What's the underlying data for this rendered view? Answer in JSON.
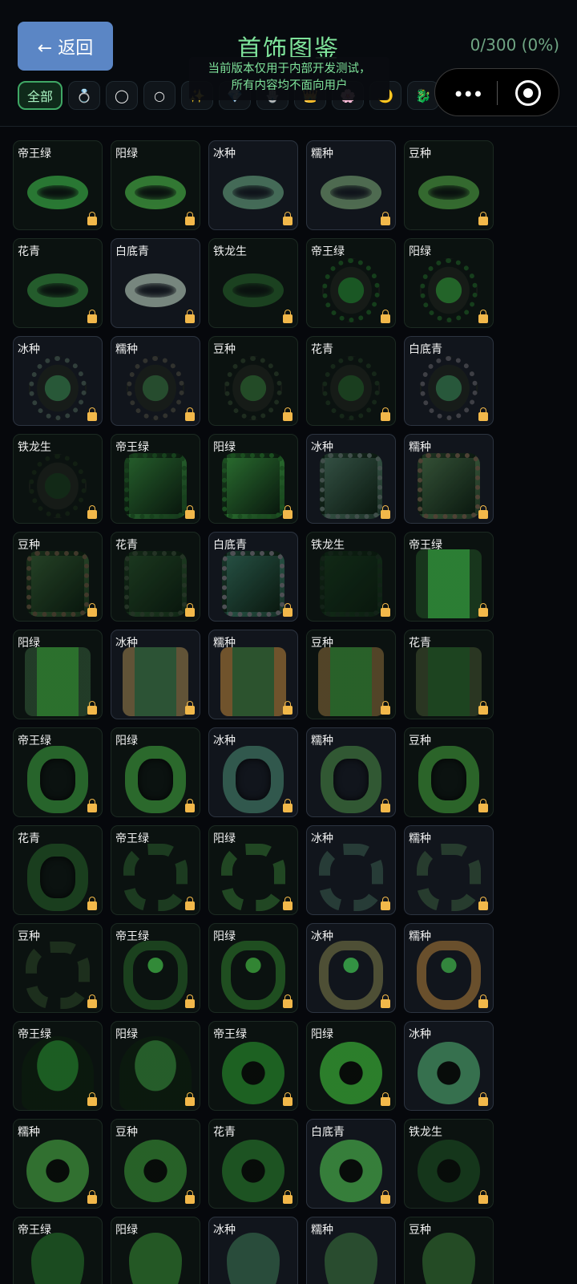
{
  "header": {
    "back_label": "← 返回",
    "title": "首饰图鉴",
    "progress": "0/300 (0%)",
    "notice_line1": "当前版本仅用于内部开发测试，",
    "notice_line2": "所有内容均不面向用户"
  },
  "filters": [
    {
      "label": "全部",
      "active": true
    },
    {
      "icon": "ring-icon",
      "glyph": "💍"
    },
    {
      "icon": "bracelet-icon",
      "glyph": "◯"
    },
    {
      "icon": "circle-icon",
      "glyph": "○"
    },
    {
      "icon": "sparkle-icon",
      "glyph": "✨"
    },
    {
      "icon": "gem-icon",
      "glyph": "💎"
    },
    {
      "icon": "pendant-icon",
      "glyph": "🪬"
    },
    {
      "icon": "crown-icon",
      "glyph": "👑"
    },
    {
      "icon": "flower-icon",
      "glyph": "🌸"
    },
    {
      "icon": "moon-icon",
      "glyph": "🌙"
    },
    {
      "icon": "dragon-icon",
      "glyph": "🐉"
    }
  ],
  "accent_color": "#7fe49b",
  "items": [
    {
      "label": "帝王绿",
      "shape": "ring",
      "c": "#2f8a3a",
      "c2": "#1d4a22"
    },
    {
      "label": "阳绿",
      "shape": "ring",
      "c": "#3a8b3a",
      "c2": "#1d4a22"
    },
    {
      "label": "冰种",
      "shape": "ring",
      "c": "#4e7a62",
      "c2": "#223a2e",
      "light": true
    },
    {
      "label": "糯种",
      "shape": "ring",
      "c": "#5a7a5a",
      "c2": "#2a3a2a",
      "light": true
    },
    {
      "label": "豆种",
      "shape": "ring",
      "c": "#3c7a35",
      "c2": "#1d4a22"
    },
    {
      "label": "花青",
      "shape": "ring",
      "c": "#2a6a32",
      "c2": "#163a1c"
    },
    {
      "label": "白底青",
      "shape": "ring",
      "c": "#8a9a90",
      "c2": "#3a4a40",
      "light": true
    },
    {
      "label": "铁龙生",
      "shape": "ring",
      "c": "#1f4a24",
      "c2": "#102a14"
    },
    {
      "label": "帝王绿",
      "shape": "oval",
      "c": "#1f6a2a",
      "c2": "#184a1e"
    },
    {
      "label": "阳绿",
      "shape": "oval",
      "c": "#2a7a30",
      "c2": "#1a4a20"
    },
    {
      "label": "冰种",
      "shape": "oval",
      "c": "#2f6a40",
      "c2": "#3a4a44",
      "light": true
    },
    {
      "label": "糯种",
      "shape": "oval",
      "c": "#2c5a34",
      "c2": "#3a3a34",
      "light": true
    },
    {
      "label": "豆种",
      "shape": "oval",
      "c": "#2a5a2e",
      "c2": "#243424"
    },
    {
      "label": "花青",
      "shape": "oval",
      "c": "#1e4a24",
      "c2": "#1a2e1c"
    },
    {
      "label": "白底青",
      "shape": "oval",
      "c": "#2f6a44",
      "c2": "#4a4a50",
      "light": true
    },
    {
      "label": "铁龙生",
      "shape": "oval",
      "c": "#14301a",
      "c2": "#142414"
    },
    {
      "label": "帝王绿",
      "shape": "square",
      "c": "#2a6a30",
      "c2": "#1a4a20"
    },
    {
      "label": "阳绿",
      "shape": "square",
      "c": "#2f7a34",
      "c2": "#1f5a24"
    },
    {
      "label": "冰种",
      "shape": "square",
      "c": "#3a5a4a",
      "c2": "#4a5a54",
      "light": true
    },
    {
      "label": "糯种",
      "shape": "square",
      "c": "#3a5a3a",
      "c2": "#5a4a3a",
      "light": true
    },
    {
      "label": "豆种",
      "shape": "square",
      "c": "#2a4a2a",
      "c2": "#4a4030"
    },
    {
      "label": "花青",
      "shape": "square",
      "c": "#1f3f22",
      "c2": "#2a3a2a"
    },
    {
      "label": "白底青",
      "shape": "square",
      "c": "#2a5a4a",
      "c2": "#5a5a5e",
      "light": true
    },
    {
      "label": "铁龙生",
      "shape": "square",
      "c": "#132e18",
      "c2": "#16261a"
    },
    {
      "label": "帝王绿",
      "shape": "rect",
      "c": "#2f8a38",
      "c2": "#1a3a1e"
    },
    {
      "label": "阳绿",
      "shape": "rect",
      "c": "#2f7a30",
      "c2": "#24402a"
    },
    {
      "label": "冰种",
      "shape": "rect",
      "c": "#2f5a38",
      "c2": "#6a5a3a",
      "light": true
    },
    {
      "label": "糯种",
      "shape": "rect",
      "c": "#2f5a30",
      "c2": "#7a5a2e",
      "light": true
    },
    {
      "label": "豆种",
      "shape": "rect",
      "c": "#2c6a2c",
      "c2": "#5a4a2a"
    },
    {
      "label": "花青",
      "shape": "rect",
      "c": "#1f4a22",
      "c2": "#2e3a24"
    },
    {
      "label": "帝王绿",
      "shape": "band",
      "c": "#2f7a32",
      "c2": "#1a3a1e"
    },
    {
      "label": "阳绿",
      "shape": "band",
      "c": "#348034",
      "c2": "#1a3a1e"
    },
    {
      "label": "冰种",
      "shape": "band",
      "c": "#3a6a5a",
      "c2": "#1e3a30",
      "light": true
    },
    {
      "label": "糯种",
      "shape": "band",
      "c": "#3a6a3a",
      "c2": "#223a22",
      "light": true
    },
    {
      "label": "豆种",
      "shape": "band",
      "c": "#347a30",
      "c2": "#1a3a1e"
    },
    {
      "label": "花青",
      "shape": "band",
      "c": "#1f4a22",
      "c2": "#102a14"
    },
    {
      "label": "帝王绿",
      "shape": "dragon",
      "c": "#234a26",
      "c2": "#142a16"
    },
    {
      "label": "阳绿",
      "shape": "dragon",
      "c": "#2a5a2a",
      "c2": "#14301a"
    },
    {
      "label": "冰种",
      "shape": "dragon",
      "c": "#2f4a40",
      "c2": "#1a2a24",
      "light": true
    },
    {
      "label": "糯种",
      "shape": "dragon",
      "c": "#2f4a34",
      "c2": "#1a2a1e",
      "light": true
    },
    {
      "label": "豆种",
      "shape": "dragon",
      "c": "#243a22",
      "c2": "#141f12"
    },
    {
      "label": "帝王绿",
      "shape": "cab",
      "c": "#3aa040",
      "c2": "#1f4a22"
    },
    {
      "label": "阳绿",
      "shape": "cab",
      "c": "#3a9a3a",
      "c2": "#245a24"
    },
    {
      "label": "冰种",
      "shape": "cab",
      "c": "#3aa84a",
      "c2": "#5a5a3a",
      "light": true
    },
    {
      "label": "糯种",
      "shape": "cab",
      "c": "#3a9a44",
      "c2": "#7a5a30",
      "light": true
    },
    {
      "label": "帝王绿",
      "shape": "dome",
      "c": "#1f6a26",
      "c2": "#102a14"
    },
    {
      "label": "阳绿",
      "shape": "dome",
      "c": "#2a6a2e",
      "c2": "#1a3a1e"
    },
    {
      "label": "帝王绿",
      "shape": "disc",
      "c": "#1f6a24",
      "c2": "#102a14"
    },
    {
      "label": "阳绿",
      "shape": "disc",
      "c": "#2f8a2e",
      "c2": "#1a4a1e"
    },
    {
      "label": "冰种",
      "shape": "disc",
      "c": "#3a7a54",
      "c2": "#1e3a2a",
      "light": true
    },
    {
      "label": "糯种",
      "shape": "disc",
      "c": "#357a34",
      "c2": "#1a3a1e"
    },
    {
      "label": "豆种",
      "shape": "disc",
      "c": "#2a6a2a",
      "c2": "#14301a"
    },
    {
      "label": "花青",
      "shape": "disc",
      "c": "#1f5a24",
      "c2": "#102a14"
    },
    {
      "label": "白底青",
      "shape": "disc",
      "c": "#3a8a3e",
      "c2": "#3a4a40",
      "light": true
    },
    {
      "label": "铁龙生",
      "shape": "disc",
      "c": "#163a1c",
      "c2": "#0c1e10"
    },
    {
      "label": "帝王绿",
      "shape": "drop",
      "c": "#1f5a24",
      "c2": "#102a14"
    },
    {
      "label": "阳绿",
      "shape": "drop",
      "c": "#2a6a2a",
      "c2": "#14301a"
    },
    {
      "label": "冰种",
      "shape": "drop",
      "c": "#2f5a44",
      "c2": "#1a2e24",
      "light": true
    },
    {
      "label": "糯种",
      "shape": "drop",
      "c": "#2f5a34",
      "c2": "#1a2e1e",
      "light": true
    },
    {
      "label": "豆种",
      "shape": "drop",
      "c": "#2a5a2a",
      "c2": "#14301a"
    }
  ]
}
